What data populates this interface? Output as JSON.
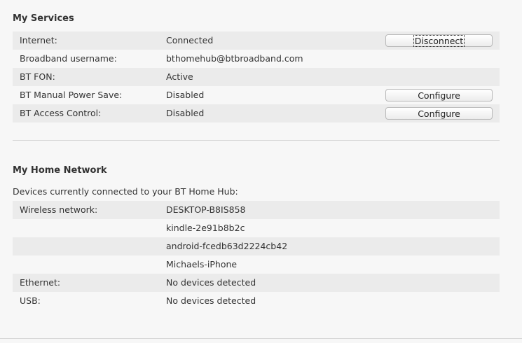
{
  "services": {
    "title": "My Services",
    "rows": [
      {
        "label": "Internet:",
        "value": "Connected",
        "button": "Disconnect"
      },
      {
        "label": "Broadband username:",
        "value": "bthomehub@btbroadband.com"
      },
      {
        "label": "BT FON:",
        "value": "Active"
      },
      {
        "label": "BT Manual Power Save:",
        "value": "Disabled",
        "button": "Configure"
      },
      {
        "label": "BT Access Control:",
        "value": "Disabled",
        "button": "Configure"
      }
    ]
  },
  "network": {
    "title": "My Home Network",
    "intro": "Devices currently connected to your BT Home Hub:",
    "rows": [
      {
        "label": "Wireless network:",
        "value": "DESKTOP-B8IS858"
      },
      {
        "label": "",
        "value": "kindle-2e91b8b2c"
      },
      {
        "label": "",
        "value": "android-fcedb63d2224cb42"
      },
      {
        "label": "",
        "value": "Michaels-iPhone"
      },
      {
        "label": "Ethernet:",
        "value": "No devices detected"
      },
      {
        "label": "USB:",
        "value": "No devices detected"
      }
    ]
  }
}
